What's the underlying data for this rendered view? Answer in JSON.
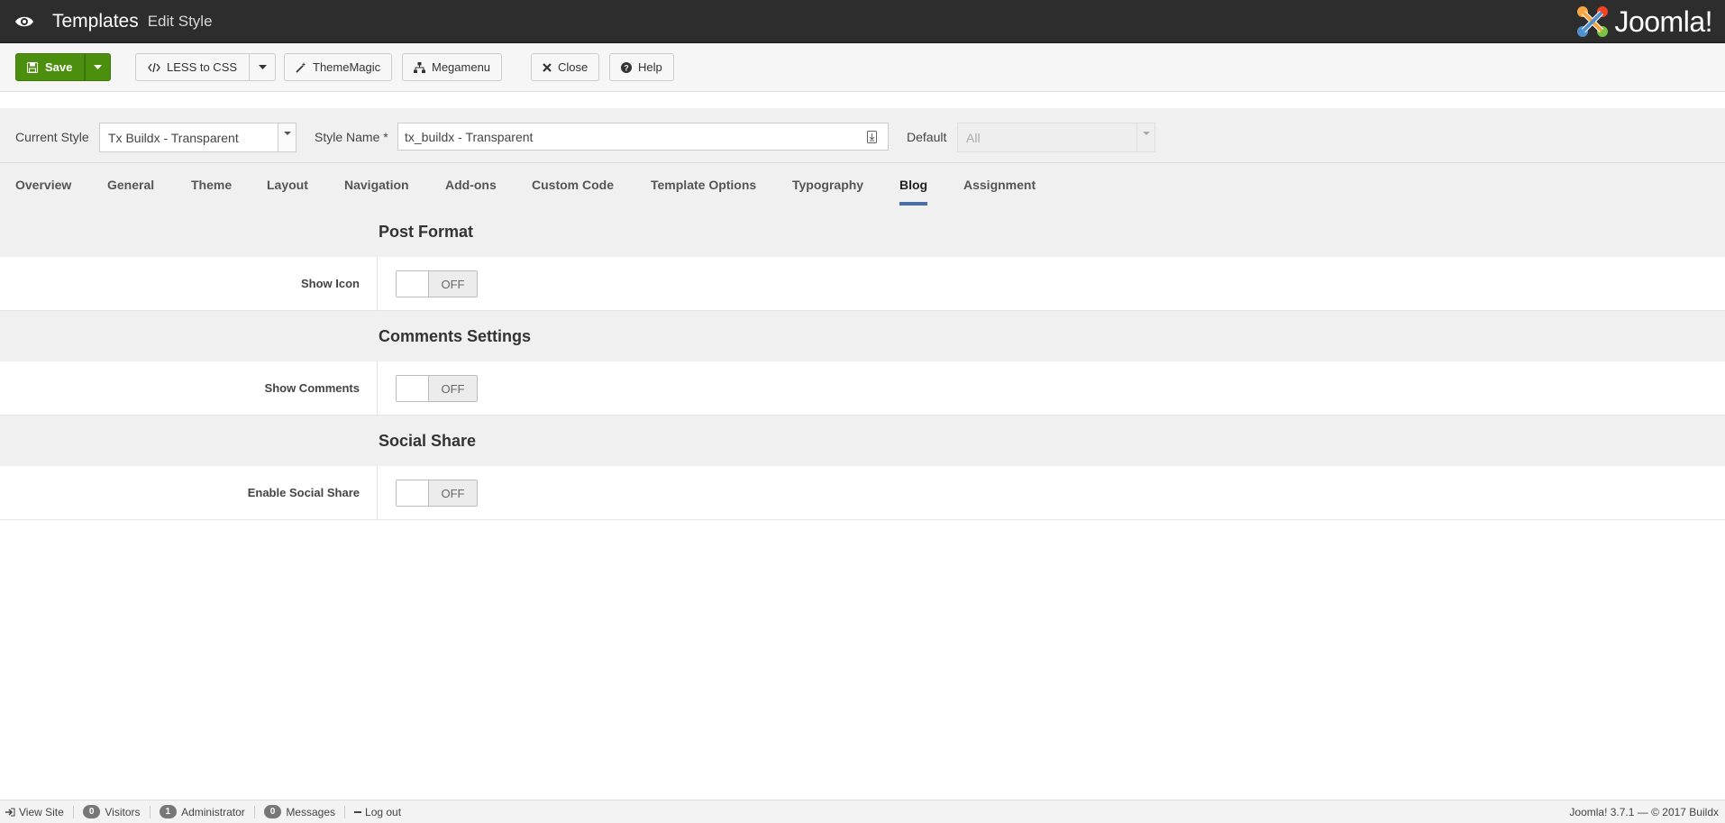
{
  "header": {
    "title": "Templates",
    "subtitle": "Edit Style",
    "logo_text": "Joomla!"
  },
  "toolbar": {
    "save_label": "Save",
    "less_label": "LESS to CSS",
    "thememagic_label": "ThemeMagic",
    "megamenu_label": "Megamenu",
    "close_label": "Close",
    "help_label": "Help"
  },
  "style_row": {
    "current_style_label": "Current Style",
    "current_style_value": "Tx Buildx - Transparent",
    "style_name_label": "Style Name *",
    "style_name_value": "tx_buildx - Transparent",
    "default_label": "Default",
    "default_value": "All"
  },
  "tabs": [
    {
      "label": "Overview"
    },
    {
      "label": "General"
    },
    {
      "label": "Theme"
    },
    {
      "label": "Layout"
    },
    {
      "label": "Navigation"
    },
    {
      "label": "Add-ons"
    },
    {
      "label": "Custom Code"
    },
    {
      "label": "Template Options"
    },
    {
      "label": "Typography"
    },
    {
      "label": "Blog"
    },
    {
      "label": "Assignment"
    }
  ],
  "active_tab": "Blog",
  "sections": [
    {
      "title": "Post Format",
      "field_label": "Show Icon",
      "toggle_state": "OFF"
    },
    {
      "title": "Comments Settings",
      "field_label": "Show Comments",
      "toggle_state": "OFF"
    },
    {
      "title": "Social Share",
      "field_label": "Enable Social Share",
      "toggle_state": "OFF"
    }
  ],
  "statusbar": {
    "view_site": "View Site",
    "visitors_count": "0",
    "visitors_label": "Visitors",
    "admin_count": "1",
    "admin_label": "Administrator",
    "messages_count": "0",
    "messages_label": "Messages",
    "logout_label": "Log out",
    "footer_text": "Joomla! 3.7.1  —  © 2017 Buildx"
  },
  "colors": {
    "header_bg": "#2d2d2d",
    "save_green": "#4c8f0f",
    "tab_active_underline": "#4a6fa5"
  }
}
